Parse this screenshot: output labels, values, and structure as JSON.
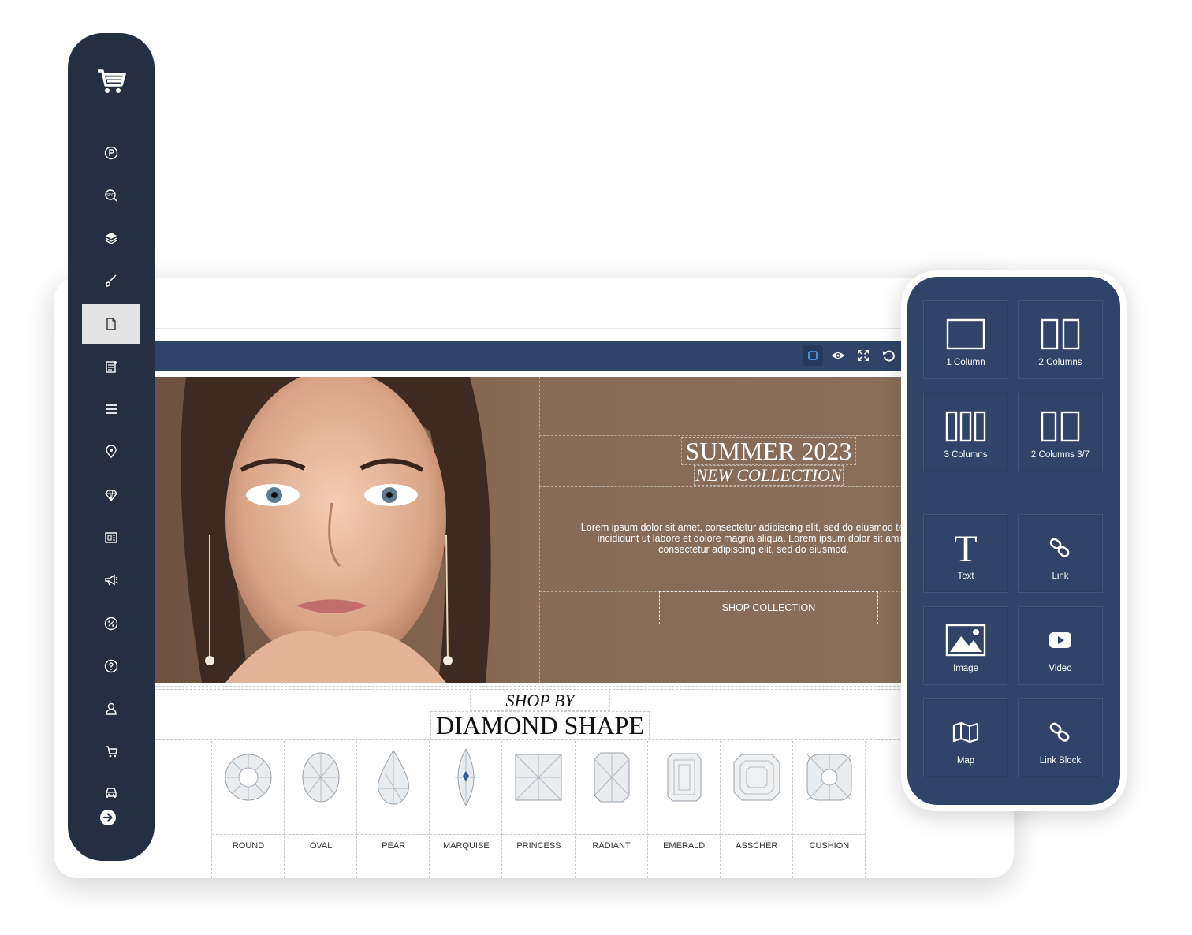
{
  "toolbar": {
    "icons": [
      "square-icon",
      "eye-icon",
      "fullscreen-icon",
      "undo-icon"
    ]
  },
  "hero": {
    "title": "SUMMER 2023",
    "subtitle": "NEW COLLECTION",
    "body": "Lorem ipsum dolor sit amet, consectetur adipiscing elit, sed do eiusmod tempor incididunt ut labore et dolore magna aliqua. Lorem ipsum dolor sit amet, consectetur adipiscing elit, sed do eiusmod.",
    "button": "SHOP COLLECTION"
  },
  "shapes": {
    "heading_small": "SHOP BY",
    "heading_large": "DIAMOND SHAPE",
    "items": [
      "ROUND",
      "OVAL",
      "PEAR",
      "MARQUISE",
      "PRINCESS",
      "RADIANT",
      "EMERALD",
      "ASSCHER",
      "CUSHION"
    ]
  },
  "sidebar": {
    "icons": [
      "cart-logo-icon",
      "p-circle-icon",
      "seo-search-icon",
      "layers-icon",
      "brush-icon",
      "page-icon",
      "article-icon",
      "menu-icon",
      "location-icon",
      "diamond-icon",
      "layout-icon",
      "megaphone-icon",
      "percent-icon",
      "help-icon",
      "user-icon",
      "cart-icon",
      "car-icon",
      "arrow-right-icon"
    ],
    "active_index": 4
  },
  "widgets": {
    "layout": [
      {
        "label": "1 Column",
        "icon": "one-column-icon"
      },
      {
        "label": "2 Columns",
        "icon": "two-columns-icon"
      },
      {
        "label": "3 Columns",
        "icon": "three-columns-icon"
      },
      {
        "label": "2 Columns 3/7",
        "icon": "two-columns-37-icon"
      }
    ],
    "elements": [
      {
        "label": "Text",
        "icon": "text-icon"
      },
      {
        "label": "Link",
        "icon": "link-icon"
      },
      {
        "label": "Image",
        "icon": "image-icon"
      },
      {
        "label": "Video",
        "icon": "video-icon"
      },
      {
        "label": "Map",
        "icon": "map-icon"
      },
      {
        "label": "Link Block",
        "icon": "link-block-icon"
      }
    ]
  },
  "colors": {
    "sidebar": "#242f43",
    "toolbar": "#2f4468",
    "hero_bg": "#876b56",
    "panel": "#2f4468"
  }
}
